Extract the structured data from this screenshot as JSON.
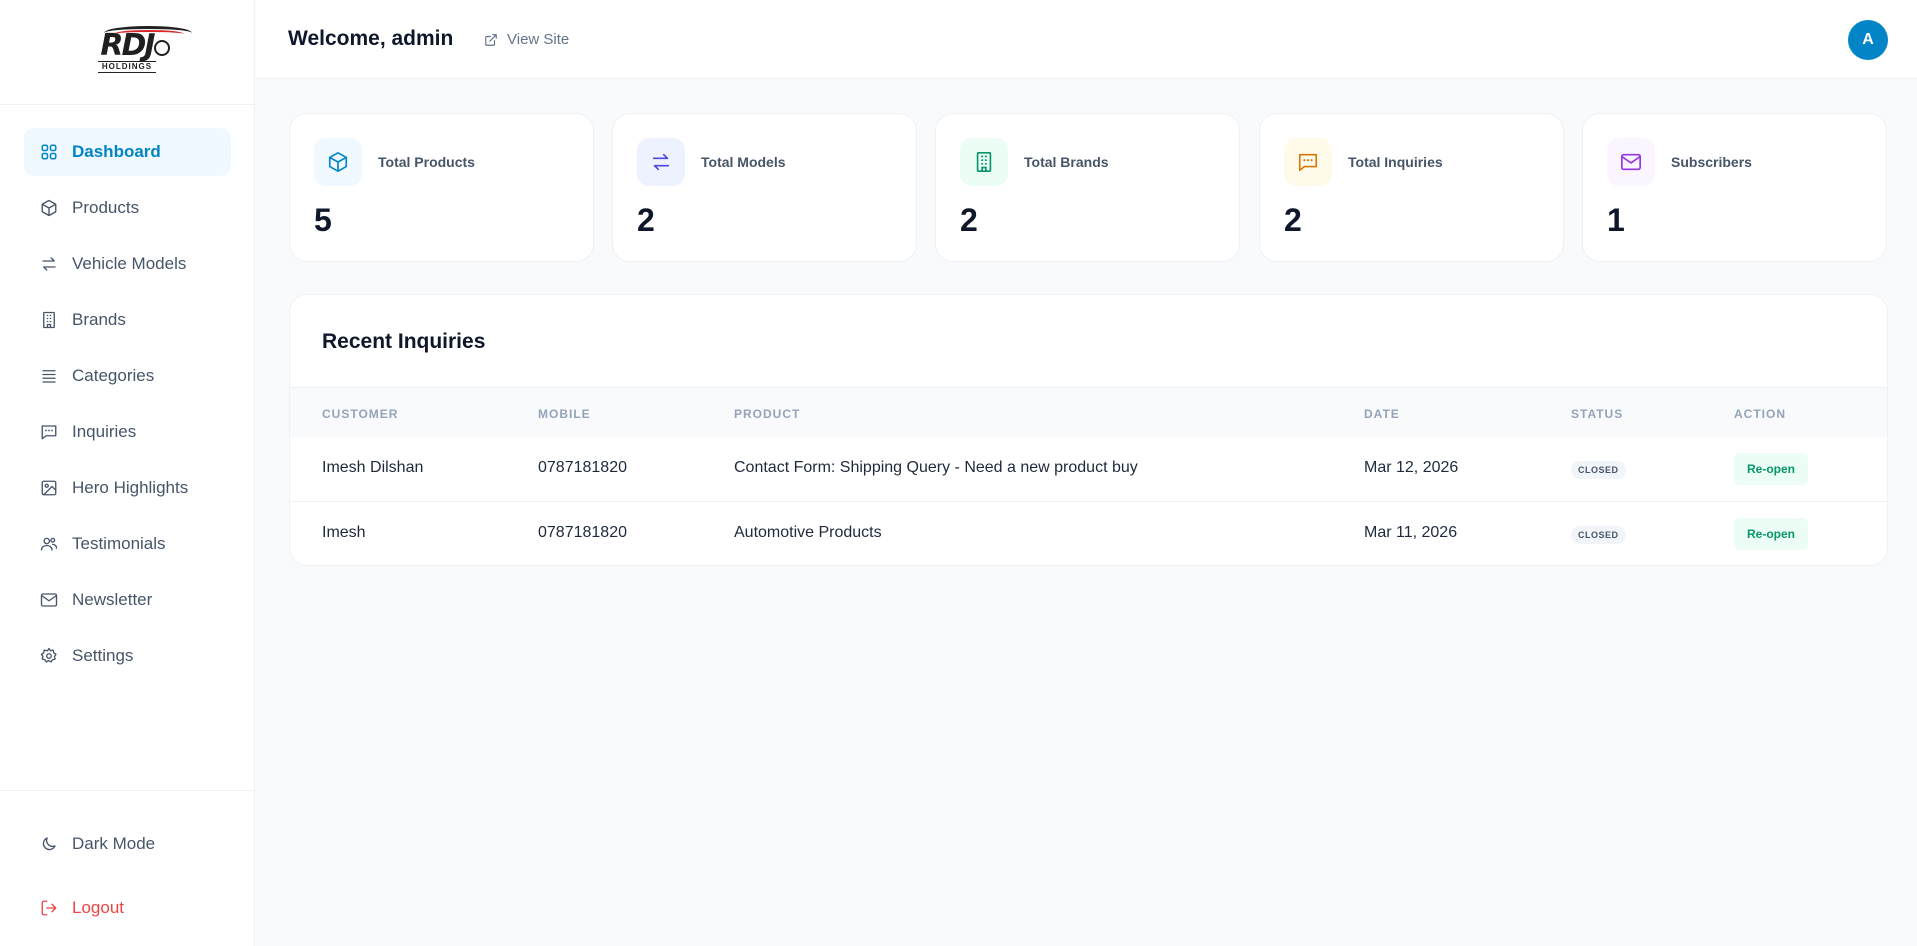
{
  "brand": {
    "logo_text": "RDJ",
    "logo_sub": "HOLDINGS"
  },
  "sidebar": {
    "items": [
      {
        "label": "Dashboard",
        "icon": "grid-icon"
      },
      {
        "label": "Products",
        "icon": "box-icon"
      },
      {
        "label": "Vehicle Models",
        "icon": "arrows-swap-icon"
      },
      {
        "label": "Brands",
        "icon": "building-icon"
      },
      {
        "label": "Categories",
        "icon": "list-icon"
      },
      {
        "label": "Inquiries",
        "icon": "message-icon"
      },
      {
        "label": "Hero Highlights",
        "icon": "image-icon"
      },
      {
        "label": "Testimonials",
        "icon": "users-icon"
      },
      {
        "label": "Newsletter",
        "icon": "mail-icon"
      },
      {
        "label": "Settings",
        "icon": "gear-icon"
      }
    ],
    "active": "Dashboard",
    "dark_mode_label": "Dark Mode",
    "logout_label": "Logout"
  },
  "header": {
    "welcome": "Welcome, admin",
    "view_site": "View Site",
    "avatar_initial": "A"
  },
  "stats": [
    {
      "label": "Total Products",
      "value": "5",
      "icon": "box-icon",
      "color": "#0284c7",
      "bg": "#f0f9ff"
    },
    {
      "label": "Total Models",
      "value": "2",
      "icon": "arrows-swap-icon",
      "color": "#4f46e5",
      "bg": "#eef2ff"
    },
    {
      "label": "Total Brands",
      "value": "2",
      "icon": "building-icon",
      "color": "#059669",
      "bg": "#ecfdf5"
    },
    {
      "label": "Total Inquiries",
      "value": "2",
      "icon": "message-icon",
      "color": "#d97706",
      "bg": "#fffbeb"
    },
    {
      "label": "Subscribers",
      "value": "1",
      "icon": "mail-icon",
      "color": "#9333ea",
      "bg": "#faf5ff"
    }
  ],
  "recent_inquiries": {
    "title": "Recent Inquiries",
    "columns": [
      "CUSTOMER",
      "MOBILE",
      "PRODUCT",
      "DATE",
      "STATUS",
      "ACTION"
    ],
    "rows": [
      {
        "customer": "Imesh Dilshan",
        "mobile": "0787181820",
        "product": "Contact Form: Shipping Query - Need a new product buy",
        "date": "Mar 12, 2026",
        "status": "CLOSED",
        "action": "Re-open"
      },
      {
        "customer": "Imesh",
        "mobile": "0787181820",
        "product": "Automotive Products",
        "date": "Mar 11, 2026",
        "status": "CLOSED",
        "action": "Re-open"
      }
    ]
  },
  "colors": {
    "accent": "#0284c7",
    "danger": "#ef4444",
    "success": "#059669"
  }
}
